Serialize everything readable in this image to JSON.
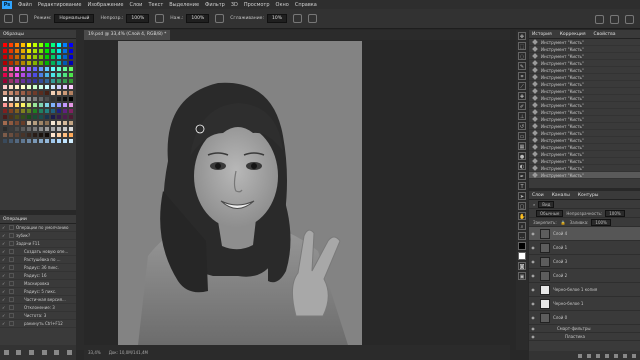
{
  "menubar": {
    "items": [
      "Файл",
      "Редактирование",
      "Изображение",
      "Слои",
      "Текст",
      "Выделение",
      "Фильтр",
      "3D",
      "Просмотр",
      "Окно",
      "Справка"
    ]
  },
  "options": {
    "mode_label": "Режим:",
    "mode_value": "Нормальный",
    "opacity_label": "Непрозр.:",
    "opacity_value": "100%",
    "flow_label": "Наж.:",
    "flow_value": "100%",
    "smoothing_label": "Сглаживание:",
    "smoothing_value": "10%"
  },
  "swatches_panel": {
    "tab": "Образцы",
    "colors": [
      "#ff0000",
      "#ff4000",
      "#ff8000",
      "#ffbf00",
      "#ffff00",
      "#bfff00",
      "#80ff00",
      "#00ff00",
      "#00ff80",
      "#00ffff",
      "#0080ff",
      "#0000ff",
      "#e60000",
      "#e63900",
      "#e67300",
      "#e6ac00",
      "#e6e600",
      "#ace600",
      "#73e600",
      "#00e600",
      "#00e673",
      "#00e6e6",
      "#0073e6",
      "#0000e6",
      "#cc0000",
      "#cc3300",
      "#cc6600",
      "#cc9900",
      "#cccc00",
      "#99cc00",
      "#66cc00",
      "#00cc00",
      "#00cc66",
      "#00cccc",
      "#0066cc",
      "#0000cc",
      "#b30000",
      "#b32d00",
      "#b35900",
      "#b38600",
      "#b3b300",
      "#86b300",
      "#59b300",
      "#00b300",
      "#00b359",
      "#00b3b3",
      "#0059b3",
      "#0000b3",
      "#ff3366",
      "#ff66b3",
      "#ff66ff",
      "#cc66ff",
      "#9966ff",
      "#6666ff",
      "#6699ff",
      "#66ccff",
      "#66ffff",
      "#66ffcc",
      "#66ff99",
      "#66ff66",
      "#e6004c",
      "#e64c99",
      "#e64ce6",
      "#b34ce6",
      "#804ce6",
      "#4c4ce6",
      "#4c80e6",
      "#4cb3e6",
      "#4ce6e6",
      "#4ce6b3",
      "#4ce680",
      "#4ce64c",
      "#990033",
      "#993366",
      "#993399",
      "#663399",
      "#4d3399",
      "#333399",
      "#334d99",
      "#336699",
      "#339999",
      "#339966",
      "#33994d",
      "#339933",
      "#ffcccc",
      "#ffe0cc",
      "#fff0cc",
      "#ffffcc",
      "#e6ffcc",
      "#ccffcc",
      "#ccffe6",
      "#ccffff",
      "#cce6ff",
      "#ccccff",
      "#e6ccff",
      "#ffccff",
      "#d9a38c",
      "#c78a6e",
      "#b3735a",
      "#9c5f48",
      "#854c38",
      "#6e3b2a",
      "#5a2d1f",
      "#472115",
      "#f2d0b5",
      "#e6b896",
      "#cc9a78",
      "#b38060",
      "#ffffff",
      "#e6e6e6",
      "#cccccc",
      "#b3b3b3",
      "#999999",
      "#808080",
      "#666666",
      "#4d4d4d",
      "#333333",
      "#1a1a1a",
      "#0d0d0d",
      "#000000",
      "#ff9999",
      "#ffb380",
      "#ffd966",
      "#fff266",
      "#c6e675",
      "#99e699",
      "#80d4b3",
      "#80d4e6",
      "#80b3ff",
      "#9999ff",
      "#c299ff",
      "#e699e6",
      "#802020",
      "#804020",
      "#806020",
      "#808020",
      "#608020",
      "#208020",
      "#208060",
      "#208080",
      "#206080",
      "#202080",
      "#602080",
      "#802060",
      "#4d1a1a",
      "#4d331a",
      "#4d4d1a",
      "#334d1a",
      "#1a4d1a",
      "#1a4d33",
      "#1a4d4d",
      "#1a334d",
      "#1a1a4d",
      "#331a4d",
      "#4d1a4d",
      "#4d1a33",
      "#a36b4f",
      "#8f5a40",
      "#7a4a33",
      "#663d29",
      "#c9b49a",
      "#b59d7f",
      "#a08668",
      "#8c7155",
      "#f5e6d3",
      "#e8d2b8",
      "#d6bb9c",
      "#c4a584",
      "#2c2c2c",
      "#3c3c3c",
      "#4c4c4c",
      "#5c5c5c",
      "#6c6c6c",
      "#7c7c7c",
      "#8c8c8c",
      "#9c9c9c",
      "#acacac",
      "#bcbcbc",
      "#cccccc",
      "#dcdcdc",
      "#7d5c4a",
      "#6b4e3f",
      "#5a4134",
      "#483429",
      "#382820",
      "#291d17",
      "#1c140f",
      "#120c09",
      "#ffe4cc",
      "#ffd1a6",
      "#ffbe80",
      "#ffab5a",
      "#394a5c",
      "#46596e",
      "#536880",
      "#607892",
      "#6d88a4",
      "#7a98b6",
      "#87a8c8",
      "#94b8da",
      "#a1c8ec",
      "#aed8fe",
      "#c0e4ff",
      "#d2eeff"
    ]
  },
  "actions_panel": {
    "tab": "Операции",
    "rows": [
      "Операции по умолчанию",
      "зубик?",
      "Задачи   F11",
      "Создать новую опе...",
      "Растушёвка по ...",
      "Радиус: 36 пикс.",
      "Радиус: 16",
      "Маскировка",
      "Радиус: 5 пикс.",
      "Частичная версия...",
      "Отклонение: 3",
      "Чистота: 3",
      "ракинуть   Ctrl+F12"
    ]
  },
  "document": {
    "tab_label": "19.psd @ 33,4% (Слой 4, RGB/8) *",
    "zoom": "33,4%",
    "doc_size": "Док: 10,0M/141,4M"
  },
  "history_panel": {
    "tabs": [
      "История",
      "Коррекция",
      "Свойства"
    ],
    "rows": [
      "Инструмент \"Кисть\"",
      "Инструмент \"Кисть\"",
      "Инструмент \"Кисть\"",
      "Инструмент \"Кисть\"",
      "Инструмент \"Кисть\"",
      "Инструмент \"Кисть\"",
      "Инструмент \"Кисть\"",
      "Инструмент \"Кисть\"",
      "Инструмент \"Кисть\"",
      "Инструмент \"Кисть\"",
      "Инструмент \"Кисть\"",
      "Инструмент \"Кисть\"",
      "Инструмент \"Кисть\"",
      "Инструмент \"Кисть\"",
      "Инструмент \"Кисть\"",
      "Инструмент \"Кисть\"",
      "Инструмент \"Кисть\"",
      "Инструмент \"Кисть\"",
      "Инструмент \"Кисть\"",
      "Инструмент \"Кисть\""
    ]
  },
  "layers_panel": {
    "tabs": [
      "Слои",
      "Каналы",
      "Контуры"
    ],
    "kind_label": "Вид",
    "blend_value": "Обычные",
    "opacity_label": "Непрозрачность:",
    "opacity_value": "100%",
    "lock_label": "Закрепить:",
    "fill_label": "Заливка:",
    "fill_value": "100%",
    "layers": [
      {
        "name": "Слой 4",
        "thumb": "dark",
        "sel": true
      },
      {
        "name": "Слой 1",
        "thumb": "dark",
        "sel": false
      },
      {
        "name": "Слой 3",
        "thumb": "dark",
        "sel": false
      },
      {
        "name": "Слой 2",
        "thumb": "dark",
        "sel": false
      },
      {
        "name": "Черно-белое 1 копия",
        "thumb": "white",
        "sel": false
      },
      {
        "name": "Черно-белое 1",
        "thumb": "white",
        "sel": false
      },
      {
        "name": "Слой 0",
        "thumb": "dark",
        "sel": false
      }
    ],
    "effects_label": "Смарт-фильтры",
    "effects": [
      "Пластика"
    ]
  }
}
